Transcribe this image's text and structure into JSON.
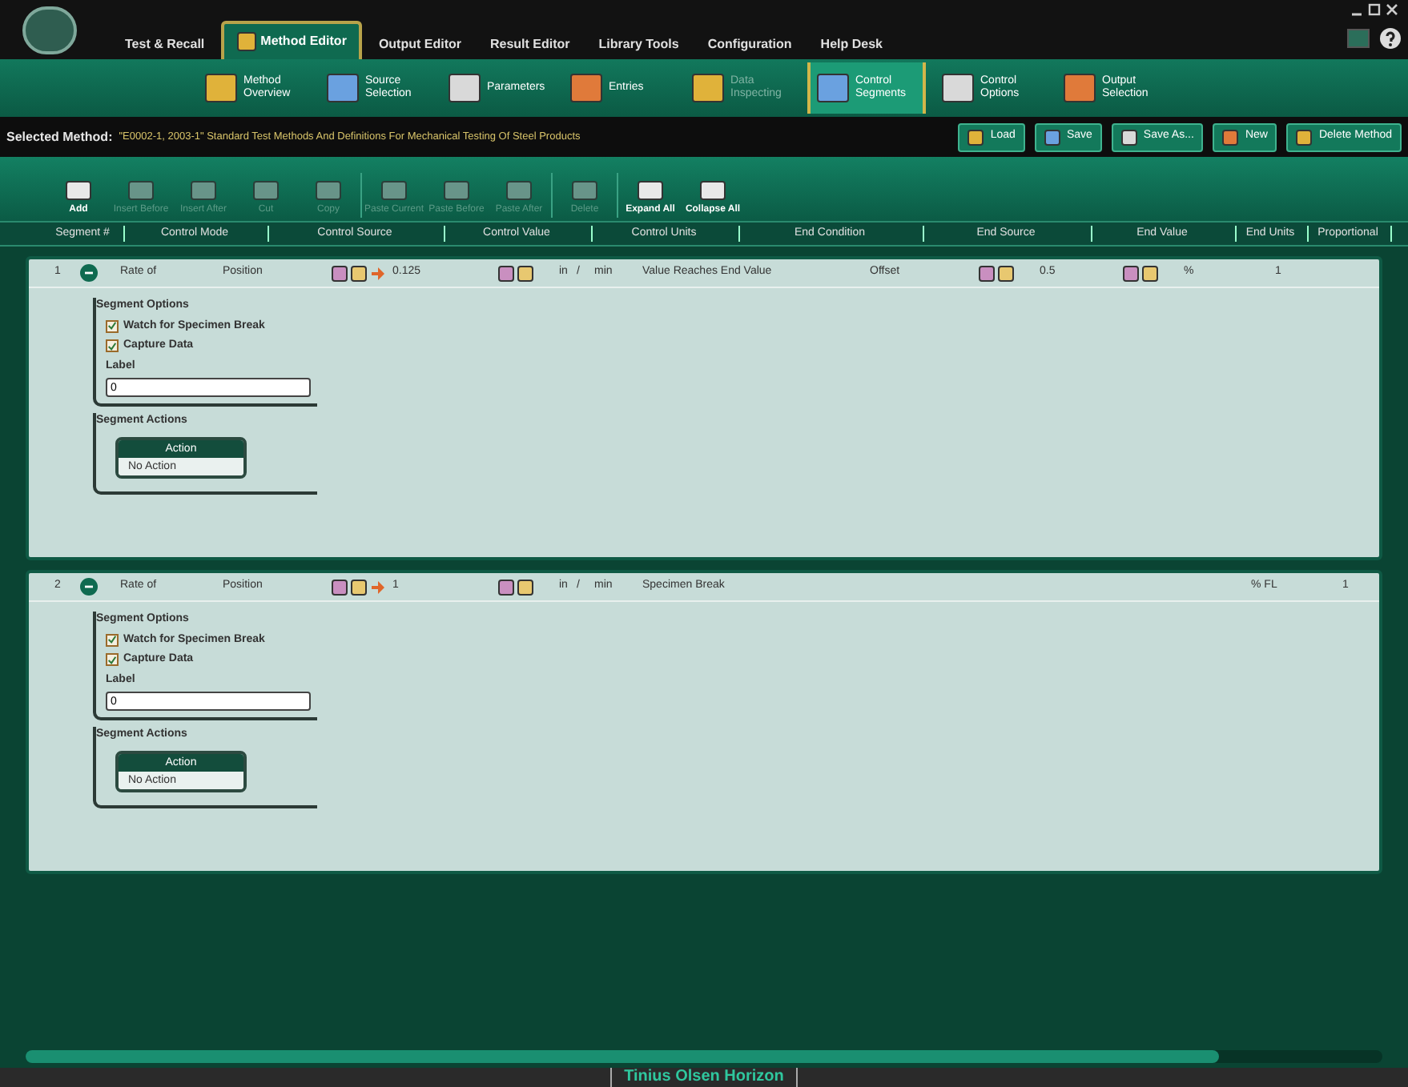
{
  "main_tabs": [
    {
      "label": "Test & Recall",
      "selected": false
    },
    {
      "label": "Method Editor",
      "selected": true
    },
    {
      "label": "Output Editor",
      "selected": false
    },
    {
      "label": "Result Editor",
      "selected": false
    },
    {
      "label": "Library Tools",
      "selected": false
    },
    {
      "label": "Configuration",
      "selected": false
    },
    {
      "label": "Help Desk",
      "selected": false
    }
  ],
  "sub_tabs": [
    {
      "label": "Method Overview",
      "selected": false,
      "disabled": false
    },
    {
      "label": "Source Selection",
      "selected": false,
      "disabled": false
    },
    {
      "label": "Parameters",
      "selected": false,
      "disabled": false
    },
    {
      "label": "Entries",
      "selected": false,
      "disabled": false
    },
    {
      "label": "Data Inspecting",
      "selected": false,
      "disabled": true
    },
    {
      "label": "Control Segments",
      "selected": true,
      "disabled": false
    },
    {
      "label": "Control Options",
      "selected": false,
      "disabled": false
    },
    {
      "label": "Output Selection",
      "selected": false,
      "disabled": false
    }
  ],
  "selected_method": {
    "label": "Selected Method:",
    "value": "\"E0002-1, 2003-1\" Standard Test Methods And Definitions For Mechanical Testing Of Steel Products"
  },
  "method_buttons": [
    "Load",
    "Save",
    "Save As...",
    "New",
    "Delete Method"
  ],
  "toolbar": [
    {
      "label": "Add",
      "disabled": false
    },
    {
      "label": "Insert Before",
      "disabled": true
    },
    {
      "label": "Insert After",
      "disabled": true
    },
    {
      "label": "Cut",
      "disabled": true
    },
    {
      "label": "Copy",
      "disabled": true
    },
    {
      "label": "Paste Current",
      "disabled": true
    },
    {
      "label": "Paste Before",
      "disabled": true
    },
    {
      "label": "Paste After",
      "disabled": true
    },
    {
      "label": "Delete",
      "disabled": true
    },
    {
      "label": "Expand All",
      "disabled": false
    },
    {
      "label": "Collapse All",
      "disabled": false
    }
  ],
  "columns": [
    "Segment #",
    "Control Mode",
    "Control Source",
    "Control Value",
    "Control Units",
    "End Condition",
    "End Source",
    "End Value",
    "End Units",
    "Proportional"
  ],
  "segments": [
    {
      "number": "1",
      "expanded": true,
      "control_mode": "Rate of",
      "control_source": "Position",
      "control_value": "0.125",
      "control_units": [
        "in",
        "/",
        "min"
      ],
      "end_condition": "Value Reaches End Value",
      "end_source": "Offset",
      "end_value": "0.5",
      "end_units": "%",
      "proportional": "1",
      "options_title": "Segment Options",
      "options": [
        {
          "label": "Watch for Specimen Break",
          "checked": true
        },
        {
          "label": "Capture Data",
          "checked": true
        }
      ],
      "label_caption": "Label",
      "label_value": "0",
      "actions_title": "Segment Actions",
      "action_header": "Action",
      "actions": [
        "No Action"
      ]
    },
    {
      "number": "2",
      "expanded": true,
      "control_mode": "Rate of",
      "control_source": "Position",
      "control_value": "1",
      "control_units": [
        "in",
        "/",
        "min"
      ],
      "end_condition": "Specimen Break",
      "end_units": "% FL",
      "proportional": "1",
      "options_title": "Segment Options",
      "options": [
        {
          "label": "Watch for Specimen Break",
          "checked": true
        },
        {
          "label": "Capture Data",
          "checked": true
        }
      ],
      "label_caption": "Label",
      "label_value": "0",
      "actions_title": "Segment Actions",
      "action_header": "Action",
      "actions": [
        "No Action"
      ]
    }
  ],
  "status_bar": "Tinius Olsen Horizon"
}
